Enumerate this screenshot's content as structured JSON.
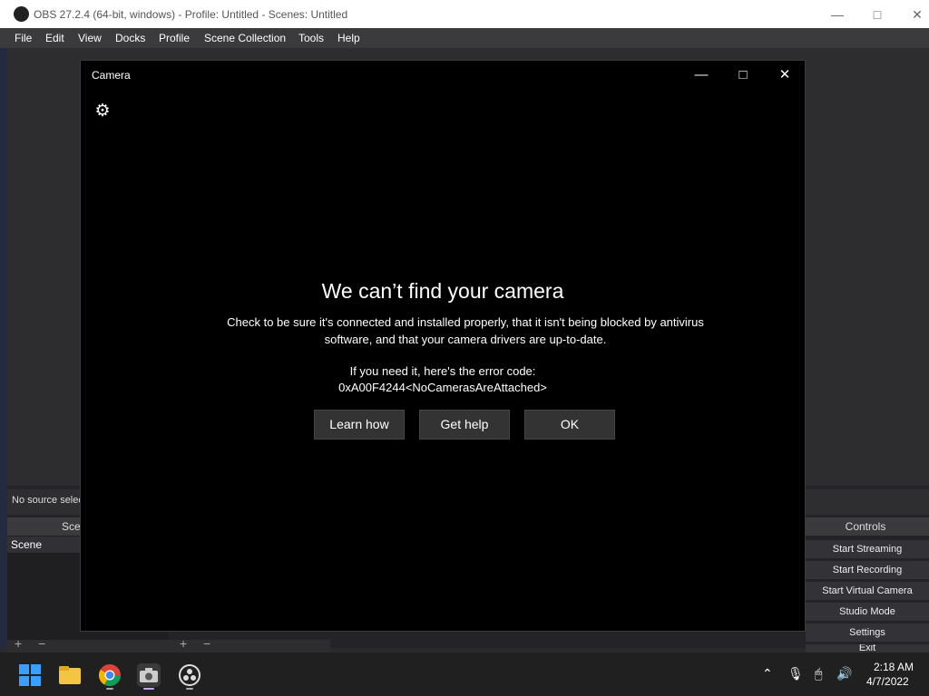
{
  "obs": {
    "title": "OBS 27.2.4 (64-bit, windows) - Profile: Untitled - Scenes: Untitled",
    "menu": [
      "File",
      "Edit",
      "View",
      "Docks",
      "Profile",
      "Scene Collection",
      "Tools",
      "Help"
    ],
    "source_status": "No source selec",
    "scenes_header": "Scer",
    "scene_item": "Scene",
    "controls_header": "Controls",
    "controls": [
      "Start Streaming",
      "Start Recording",
      "Start Virtual Camera",
      "Studio Mode",
      "Settings",
      "Exit"
    ]
  },
  "camera": {
    "title": "Camera",
    "error_title": "We can’t find your camera",
    "error_desc": "Check to be sure it's connected and installed properly, that it isn't being blocked by antivirus software, and that your camera drivers are up-to-date.",
    "error_code_label": "If you need it, here's the error code:",
    "error_code": "0xA00F4244<NoCamerasAreAttached>",
    "buttons": {
      "learn": "Learn how",
      "help": "Get help",
      "ok": "OK"
    }
  },
  "taskbar": {
    "time": "2:18 AM",
    "date": "4/7/2022",
    "icons": [
      "windows-start-icon",
      "file-explorer-icon",
      "chrome-icon",
      "camera-app-icon",
      "obs-icon"
    ]
  }
}
